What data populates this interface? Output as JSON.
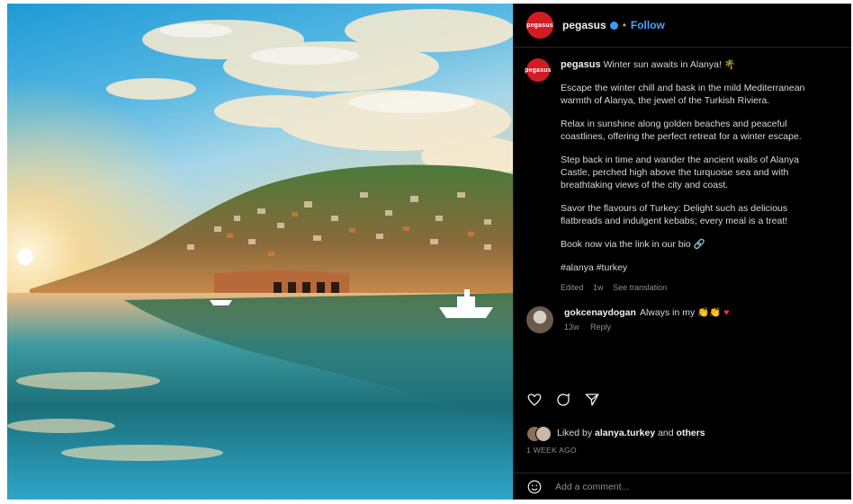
{
  "account": {
    "avatar_text": "pegasus",
    "username": "pegasus",
    "follow_label": "Follow"
  },
  "caption": {
    "paragraphs": [
      "Winter sun awaits in Alanya! 🌴",
      "Escape the winter chill and bask in the mild Mediterranean warmth of Alanya, the jewel of the Turkish Riviera.",
      "Relax in sunshine along golden beaches and peaceful coastlines, offering the perfect retreat for a winter escape.",
      "Step back in time and wander the ancient walls of Alanya Castle, perched high above the turquoise sea and with breathtaking views of the city and coast.",
      "Savor the flavours of Turkey: Delight such as delicious flatbreads and indulgent kebabs; every meal is a treat!",
      "Book now via the link in our bio 🔗",
      "#alanya #turkey"
    ],
    "meta": [
      "Edited",
      "1w",
      "See translation"
    ]
  },
  "comment": {
    "username": "gokcenaydogan",
    "text": "Always in my 👏👏",
    "heart": "♥",
    "meta": [
      "13w",
      "Reply"
    ]
  },
  "likes": {
    "text_pre": "Liked by",
    "user": "alanya.turkey",
    "and": "and",
    "others": "others"
  },
  "timestamp": "1 WEEK AGO",
  "add_comment": {
    "placeholder": "Add a comment..."
  },
  "colors": {
    "accent": "#4aa3ff",
    "brand": "#d31b24",
    "panel_bg": "#000000",
    "heart": "#e63946"
  }
}
